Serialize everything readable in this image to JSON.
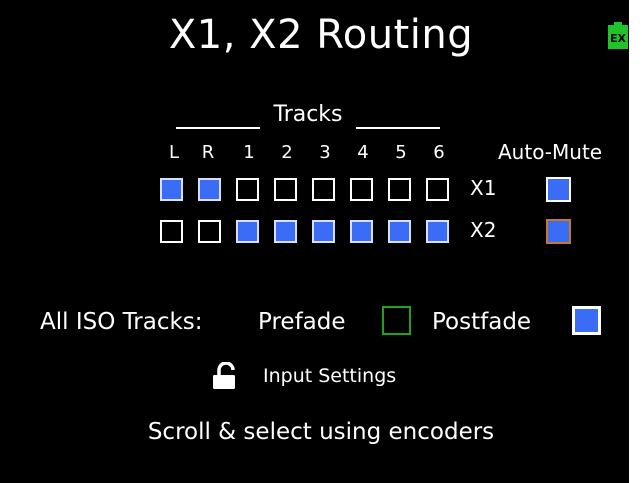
{
  "title": "X1, X2 Routing",
  "battery_icon": {
    "icon": "battery-ext-icon",
    "label": "EX",
    "color": "#22c22a"
  },
  "tracks": {
    "header": "Tracks",
    "columns": [
      "L",
      "R",
      "1",
      "2",
      "3",
      "4",
      "5",
      "6"
    ],
    "auto_mute_label": "Auto-Mute",
    "rows": [
      {
        "label": "X1",
        "cells": [
          true,
          true,
          false,
          false,
          false,
          false,
          false,
          false
        ],
        "auto_mute_color": "#3b6cf5"
      },
      {
        "label": "X2",
        "cells": [
          false,
          false,
          true,
          true,
          true,
          true,
          true,
          true
        ],
        "auto_mute_color": "#3b6cf5"
      }
    ]
  },
  "iso": {
    "label": "All ISO Tracks:",
    "prefade_label": "Prefade",
    "prefade_checked": false,
    "prefade_color": "#1fa31f",
    "postfade_label": "Postfade",
    "postfade_checked": true,
    "postfade_color": "#3b6cf5"
  },
  "input_settings": {
    "icon": "unlock-icon",
    "label": "Input Settings"
  },
  "footer": "Scroll & select using encoders",
  "colors": {
    "background": "#000000",
    "text": "#ffffff",
    "selected_fill": "#3b6cf5",
    "focus_border": "#c8782a"
  }
}
